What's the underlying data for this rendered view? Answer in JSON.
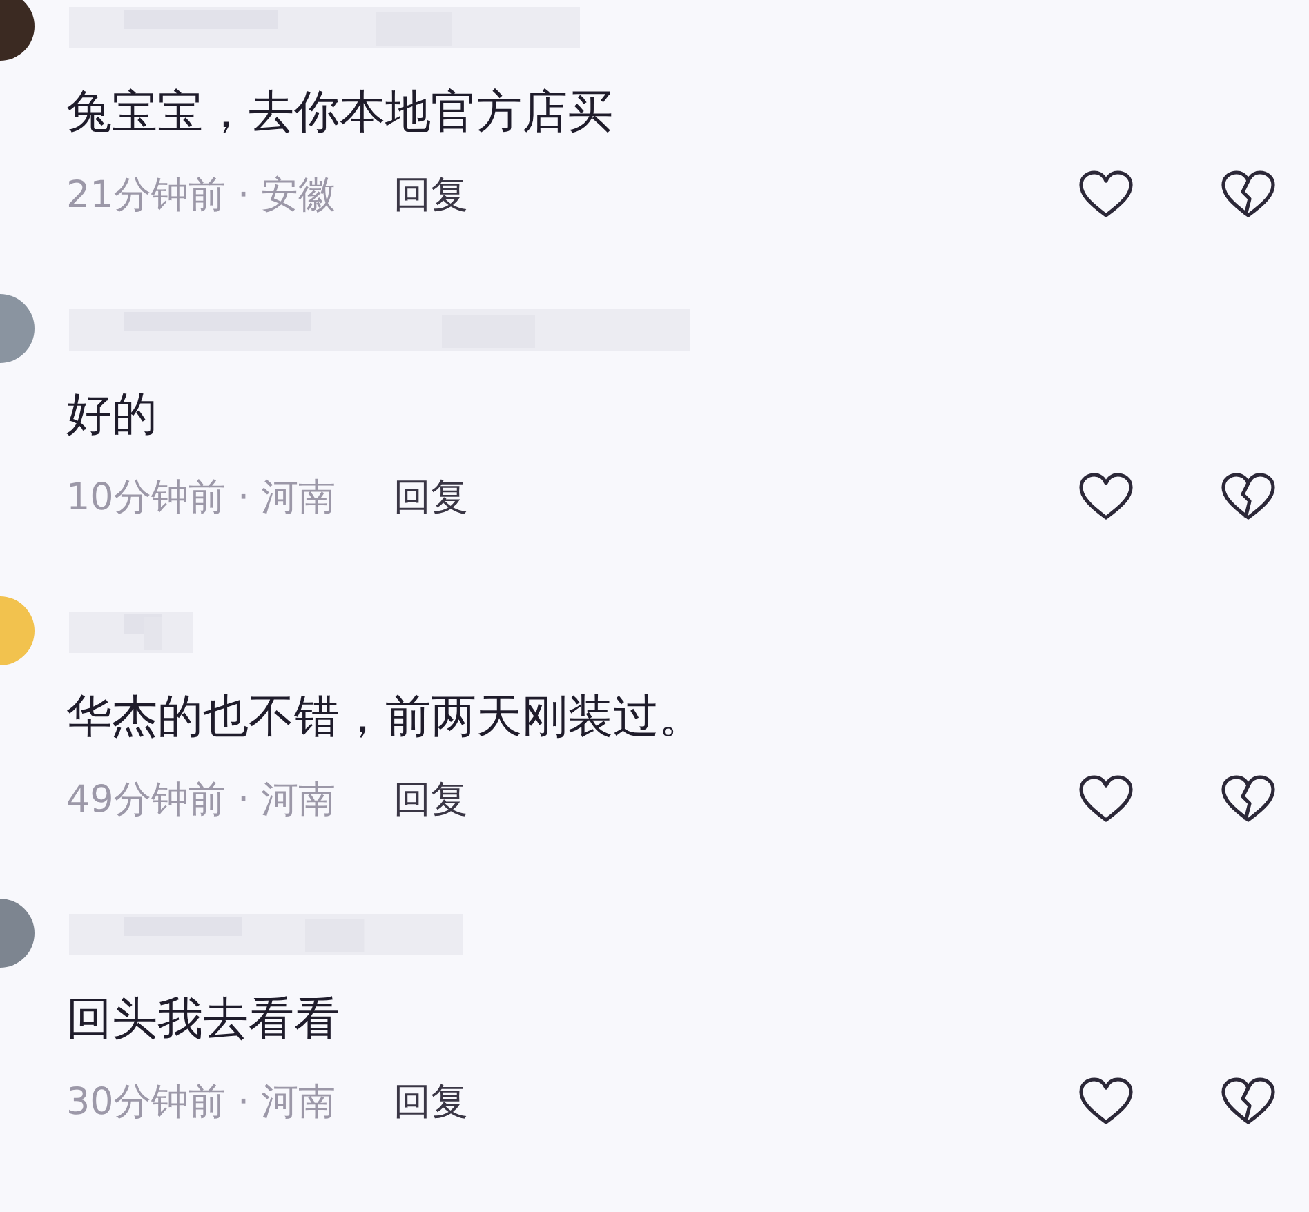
{
  "comments": [
    {
      "color": "#3b2a22",
      "text": "兔宝宝，去你本地官方店买",
      "meta": "21分钟前 · 安徽",
      "reply": "回复"
    },
    {
      "color": "#8a94a0",
      "text": "好的",
      "meta": "10分钟前 · 河南",
      "reply": "回复"
    },
    {
      "color": "#f2c24e",
      "text": "华杰的也不错，前两天刚装过。",
      "meta": "49分钟前 · 河南",
      "reply": "回复"
    },
    {
      "color": "#7d8590",
      "text": "回头我去看看",
      "meta": "30分钟前 · 河南",
      "reply": "回复"
    }
  ]
}
